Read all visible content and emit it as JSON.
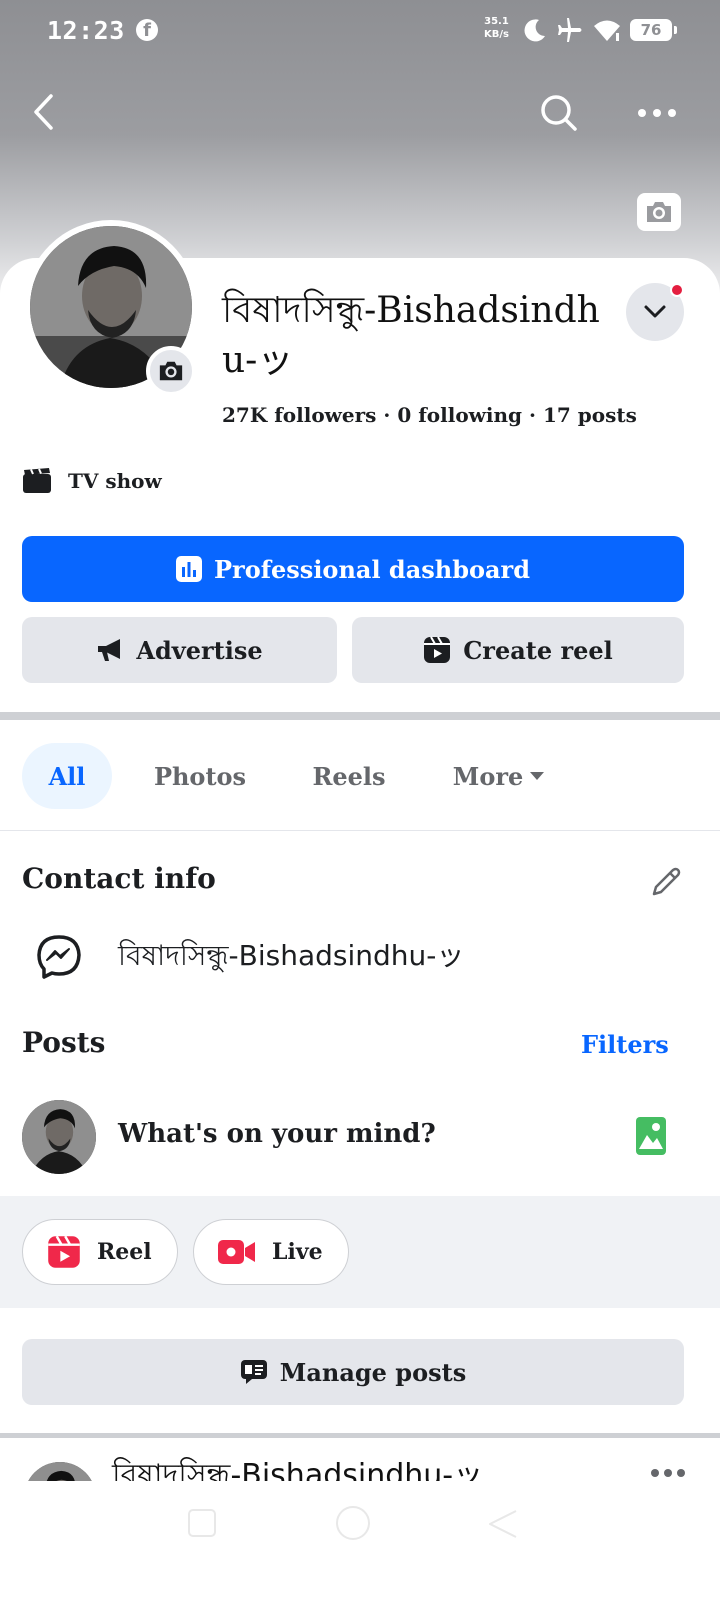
{
  "status_bar": {
    "time": "12:23",
    "app_icon": "facebook-icon",
    "net_speed": "35.1",
    "net_unit": "KB/s",
    "icons": [
      "moon-icon",
      "airplane-icon",
      "wifi-icon"
    ],
    "battery": "76"
  },
  "header": {
    "back_icon": "back-arrow-icon",
    "search_icon": "search-icon",
    "more_icon": "more-icon"
  },
  "profile": {
    "name": "বিষাদসিন্ধু-Bishadsindhu-ッ",
    "followers_count": "27K",
    "followers_label": "followers",
    "following_count": "0",
    "following_label": "following",
    "posts_count": "17",
    "posts_label": "posts",
    "category": "TV show"
  },
  "actions": {
    "professional_dashboard": "Professional dashboard",
    "advertise": "Advertise",
    "create_reel": "Create reel"
  },
  "tabs": [
    {
      "label": "All",
      "active": true
    },
    {
      "label": "Photos",
      "active": false
    },
    {
      "label": "Reels",
      "active": false
    },
    {
      "label": "More",
      "active": false
    }
  ],
  "contact_info": {
    "title": "Contact info",
    "messenger_name": "বিষাদসিন্ধু-Bishadsindhu-ッ"
  },
  "posts": {
    "title": "Posts",
    "filters_label": "Filters",
    "composer_placeholder": "What's on your mind?",
    "chips": {
      "reel": "Reel",
      "live": "Live"
    },
    "manage_posts": "Manage posts",
    "first_post_author": "বিষাদসিন্ধু-Bishadsindhu-ッ"
  },
  "colors": {
    "primary": "#0866ff",
    "button_gray": "#e4e6eb",
    "notification_red": "#e41e3f",
    "reel_red": "#f0284a",
    "photo_green": "#45bd62"
  }
}
